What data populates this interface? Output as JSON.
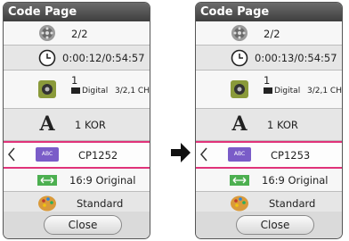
{
  "before": {
    "title": "Code Page",
    "rows": {
      "title_number": "2/2",
      "time": "0:00:12/0:54:57",
      "audio_track": "1",
      "audio_codec": "Digital",
      "audio_channels": "3/2,1 CH",
      "subtitle_language": "1 KOR",
      "code_page": "CP1252",
      "aspect_ratio": "16:9 Original",
      "picture_mode": "Standard"
    },
    "close_label": "Close"
  },
  "after": {
    "title": "Code Page",
    "rows": {
      "title_number": "2/2",
      "time": "0:00:13/0:54:57",
      "audio_track": "1",
      "audio_codec": "Digital",
      "audio_channels": "3/2,1 CH",
      "subtitle_language": "1 KOR",
      "code_page": "CP1253",
      "aspect_ratio": "16:9 Original",
      "picture_mode": "Standard"
    },
    "close_label": "Close"
  },
  "icons": {
    "title_number": "film-reel-icon",
    "time": "clock-icon",
    "audio": "speaker-icon",
    "subtitle": "font-a-icon",
    "code_page": "abc-code-icon",
    "aspect_ratio": "aspect-arrows-icon",
    "picture_mode": "palette-icon",
    "transition": "right-arrow-icon"
  },
  "font_glyph": "A",
  "code_badge": "ABC",
  "colors": {
    "highlight": "#e0337a",
    "title_bar": "#4a4a4a"
  }
}
